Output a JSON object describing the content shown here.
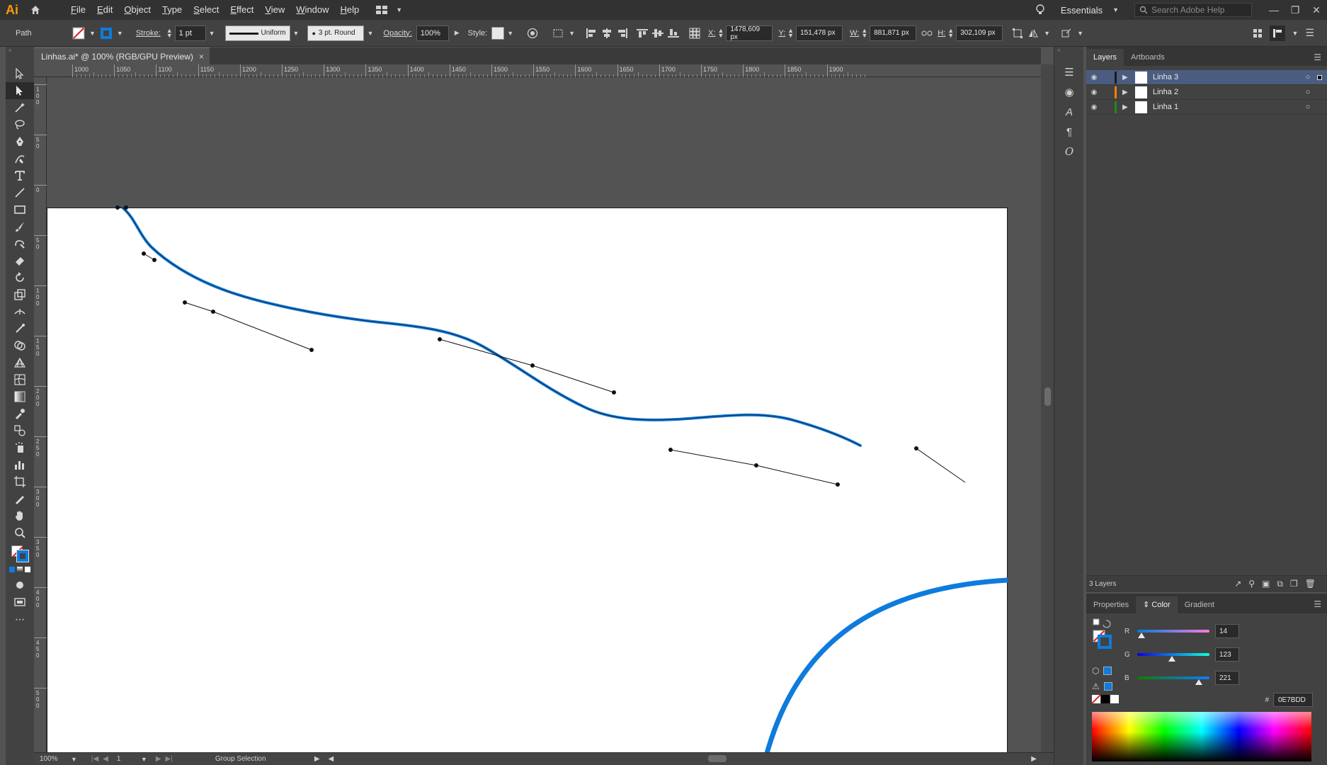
{
  "app": {
    "logo": "Ai"
  },
  "menu": {
    "items": [
      {
        "u": "F",
        "rest": "ile"
      },
      {
        "u": "E",
        "rest": "dit"
      },
      {
        "u": "O",
        "rest": "bject"
      },
      {
        "u": "T",
        "rest": "ype"
      },
      {
        "u": "S",
        "rest": "elect"
      },
      {
        "u": "E",
        "rest": "ffect"
      },
      {
        "u": "V",
        "rest": "iew"
      },
      {
        "u": "W",
        "rest": "indow"
      },
      {
        "u": "H",
        "rest": "elp"
      }
    ]
  },
  "workspace": {
    "name": "Essentials"
  },
  "search": {
    "placeholder": "Search Adobe Help"
  },
  "control": {
    "selection_type": "Path",
    "stroke_label": "Stroke:",
    "stroke_weight": "1 pt",
    "profile": "Uniform",
    "brush": "3 pt. Round",
    "opacity_label": "Opacity:",
    "opacity": "100%",
    "style_label": "Style:",
    "x_label": "X:",
    "x": "1478,609 px",
    "y_label": "Y:",
    "y": "151,478 px",
    "w_label": "W:",
    "w": "881,871 px",
    "h_label": "H:",
    "h": "302,109 px"
  },
  "document": {
    "tab_title": "Linhas.ai* @ 100% (RGB/GPU Preview)",
    "close": "×"
  },
  "ruler": {
    "h_ticks": [
      "1000",
      "1050",
      "1100",
      "1150",
      "1200",
      "1250",
      "1300",
      "1350",
      "1400",
      "1450",
      "1500",
      "1550",
      "1600",
      "1650",
      "1700",
      "1750",
      "1800",
      "1850",
      "1900"
    ],
    "v_ticks": [
      "1\n0\n0",
      "5\n0",
      "0",
      "5\n0",
      "1\n0\n0",
      "1\n5\n0",
      "2\n0\n0",
      "2\n5\n0",
      "3\n0\n0",
      "3\n5\n0",
      "4\n0\n0",
      "4\n5\n0",
      "5\n0\n0"
    ]
  },
  "status": {
    "zoom": "100%",
    "page": "1",
    "tool": "Group Selection"
  },
  "layers": {
    "tabs": [
      "Layers",
      "Artboards"
    ],
    "rows": [
      {
        "name": "Linha 3",
        "color": "#1a1a1a",
        "selected": true
      },
      {
        "name": "Linha 2",
        "color": "#ff7f00",
        "selected": false
      },
      {
        "name": "Linha 1",
        "color": "#1f8a1f",
        "selected": false
      }
    ],
    "count": "3 Layers"
  },
  "color_panel": {
    "tabs": [
      "Properties",
      "Color",
      "Gradient"
    ],
    "r_label": "R",
    "r": "14",
    "g_label": "G",
    "g": "123",
    "b_label": "B",
    "b": "221",
    "hex_label": "#",
    "hex": "0E7BDD",
    "stroke_color": "#0E7BDD"
  },
  "colors": {
    "accent_stroke": "#0E7BDD",
    "selection_highlight": "#4a5d80"
  }
}
